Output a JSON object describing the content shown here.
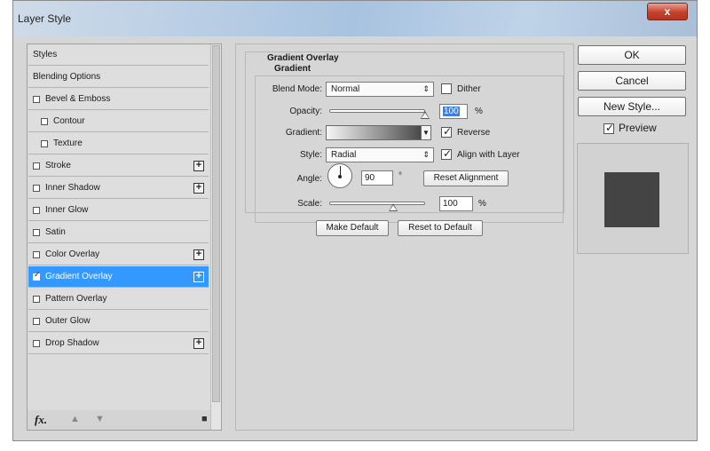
{
  "window": {
    "title": "Layer Style",
    "close_glyph": "x"
  },
  "styles_list": {
    "items": [
      {
        "label": "Styles",
        "checkbox": false,
        "checked": false,
        "indent": false,
        "plus": false,
        "selected": false
      },
      {
        "label": "Blending Options",
        "checkbox": false,
        "checked": false,
        "indent": false,
        "plus": false,
        "selected": false
      },
      {
        "label": "Bevel & Emboss",
        "checkbox": true,
        "checked": false,
        "indent": false,
        "plus": false,
        "selected": false
      },
      {
        "label": "Contour",
        "checkbox": true,
        "checked": false,
        "indent": true,
        "plus": false,
        "selected": false
      },
      {
        "label": "Texture",
        "checkbox": true,
        "checked": false,
        "indent": true,
        "plus": false,
        "selected": false
      },
      {
        "label": "Stroke",
        "checkbox": true,
        "checked": false,
        "indent": false,
        "plus": true,
        "selected": false
      },
      {
        "label": "Inner Shadow",
        "checkbox": true,
        "checked": false,
        "indent": false,
        "plus": true,
        "selected": false
      },
      {
        "label": "Inner Glow",
        "checkbox": true,
        "checked": false,
        "indent": false,
        "plus": false,
        "selected": false
      },
      {
        "label": "Satin",
        "checkbox": true,
        "checked": false,
        "indent": false,
        "plus": false,
        "selected": false
      },
      {
        "label": "Color Overlay",
        "checkbox": true,
        "checked": false,
        "indent": false,
        "plus": true,
        "selected": false
      },
      {
        "label": "Gradient Overlay",
        "checkbox": true,
        "checked": true,
        "indent": false,
        "plus": true,
        "selected": true
      },
      {
        "label": "Pattern Overlay",
        "checkbox": true,
        "checked": false,
        "indent": false,
        "plus": false,
        "selected": false
      },
      {
        "label": "Outer Glow",
        "checkbox": true,
        "checked": false,
        "indent": false,
        "plus": false,
        "selected": false
      },
      {
        "label": "Drop Shadow",
        "checkbox": true,
        "checked": false,
        "indent": false,
        "plus": true,
        "selected": false
      }
    ],
    "footer": {
      "fx_label": "fx",
      "fx_suffix": ".",
      "up_icon": "arrow-up-icon",
      "down_icon": "arrow-down-icon",
      "trash_icon": "trash-icon"
    }
  },
  "gradient_overlay": {
    "section_title": "Gradient Overlay",
    "subsection_title": "Gradient",
    "blend_mode_label": "Blend Mode:",
    "blend_mode_value": "Normal",
    "dither_label": "Dither",
    "dither_checked": false,
    "opacity_label": "Opacity:",
    "opacity_value": "100",
    "opacity_unit": "%",
    "opacity_slider_fraction": 1.0,
    "gradient_label": "Gradient:",
    "reverse_label": "Reverse",
    "reverse_checked": true,
    "style_label": "Style:",
    "style_value": "Radial",
    "align_label": "Align with Layer",
    "align_checked": true,
    "angle_label": "Angle:",
    "angle_value": "90",
    "angle_unit": "°",
    "reset_alignment_label": "Reset Alignment",
    "scale_label": "Scale:",
    "scale_value": "100",
    "scale_unit": "%",
    "scale_slider_fraction": 0.67,
    "make_default_label": "Make Default",
    "reset_default_label": "Reset to Default"
  },
  "actions": {
    "ok_label": "OK",
    "cancel_label": "Cancel",
    "new_style_label": "New Style...",
    "preview_label": "Preview",
    "preview_checked": true
  },
  "colors": {
    "selection": "#3399ff",
    "preview_swatch": "#444444",
    "dialog_bg": "#d6d6d6"
  }
}
